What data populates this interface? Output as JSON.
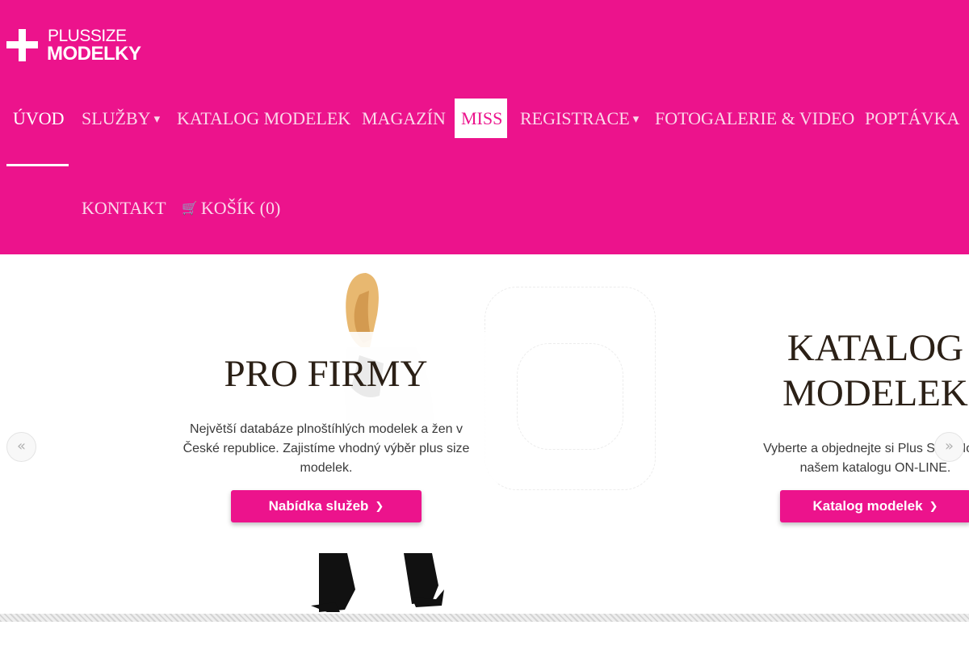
{
  "brand": {
    "line1": "PLUSSIZE",
    "line2": "MODELKY"
  },
  "nav": {
    "uvod": "ÚVOD",
    "sluzby": "SLUŽBY",
    "katalog": "KATALOG MODELEK",
    "magazin": "MAGAZÍN",
    "miss": "MISS",
    "registrace": "REGISTRACE",
    "fotogalerie": "FOTOGALERIE & VIDEO",
    "poptavka": "POPTÁVKA",
    "kontakt": "KONTAKT",
    "kosik": "KOŠÍK (0)"
  },
  "icons": {
    "dropdown": "caret-down-icon",
    "cart": "cart-icon",
    "button_arrow": "chevron-right-icon",
    "slider_prev": "double-chevron-left-icon",
    "slider_next": "double-chevron-right-icon"
  },
  "slides": [
    {
      "title": "PRO FIRMY",
      "description": "Největší databáze plnoštíhlých modelek a žen v České republice. Zajistíme vhodný výběr plus size modelek.",
      "button": "Nabídka služeb"
    },
    {
      "title_line1": "KATALOG",
      "title_line2": "MODELEK",
      "desc_line1": "Vyberte a objednejte si Plus Size Mode",
      "desc_line2": "našem katalogu ON-LINE.",
      "button": "Katalog modelek"
    }
  ],
  "colors": {
    "brand_pink": "#ec138c",
    "nav_text": "#fbd9ea",
    "title_text": "#2b2016"
  }
}
